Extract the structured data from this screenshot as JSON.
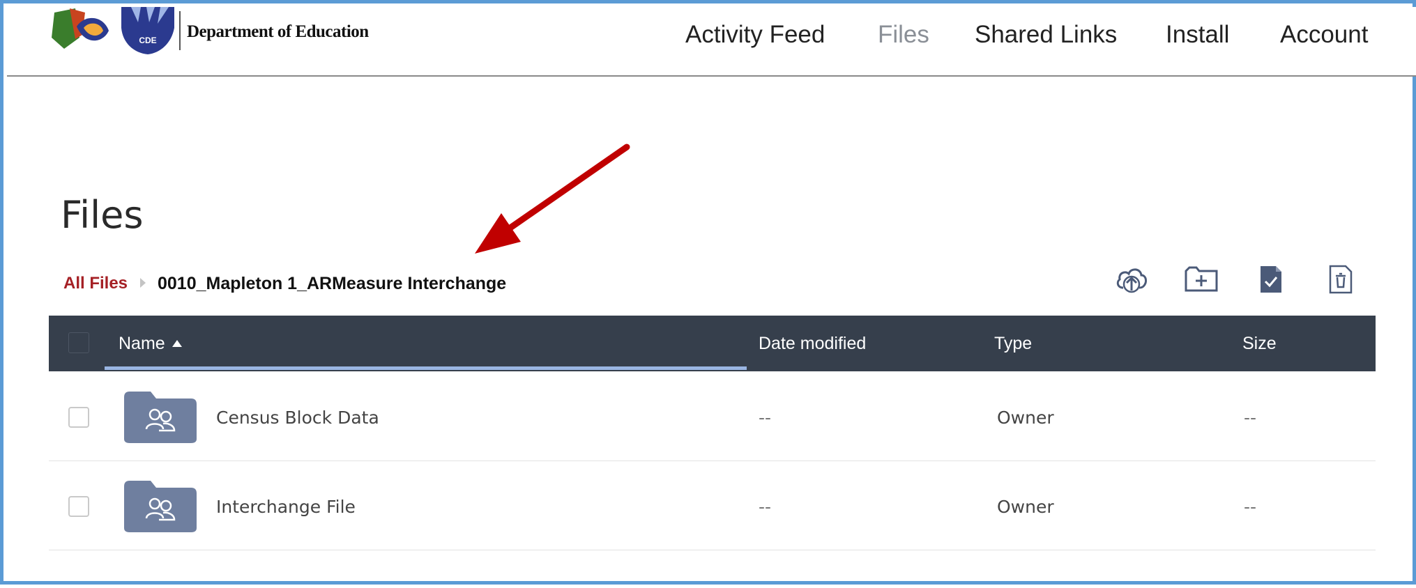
{
  "header": {
    "org_name": "Department of Education",
    "logo_badge": "CDE",
    "nav": [
      {
        "label": "Activity Feed",
        "active": false
      },
      {
        "label": "Files",
        "active": true
      },
      {
        "label": "Shared Links",
        "active": false
      },
      {
        "label": "Install",
        "active": false
      },
      {
        "label": "Account",
        "active": false
      }
    ]
  },
  "page": {
    "title": "Files"
  },
  "breadcrumb": {
    "root": "All Files",
    "current": "0010_Mapleton 1_ARMeasure Interchange"
  },
  "toolbar": {
    "icons": [
      "cloud-upload-icon",
      "new-folder-icon",
      "new-file-icon",
      "trash-icon"
    ]
  },
  "table": {
    "columns": {
      "name": "Name",
      "date_modified": "Date modified",
      "type": "Type",
      "size": "Size"
    },
    "sort": {
      "column": "name",
      "direction": "ascending"
    },
    "rows": [
      {
        "name": "Census Block Data",
        "date_modified": "--",
        "type": "Owner",
        "size": "--",
        "icon": "shared-folder-icon"
      },
      {
        "name": "Interchange File",
        "date_modified": "--",
        "type": "Owner",
        "size": "--",
        "icon": "shared-folder-icon"
      }
    ]
  },
  "colors": {
    "header_bar": "#363f4c",
    "breadcrumb_link": "#a52025",
    "folder": "#6f7f9f",
    "annotation_arrow": "#c00000",
    "frame_border": "#5b9bd5"
  }
}
